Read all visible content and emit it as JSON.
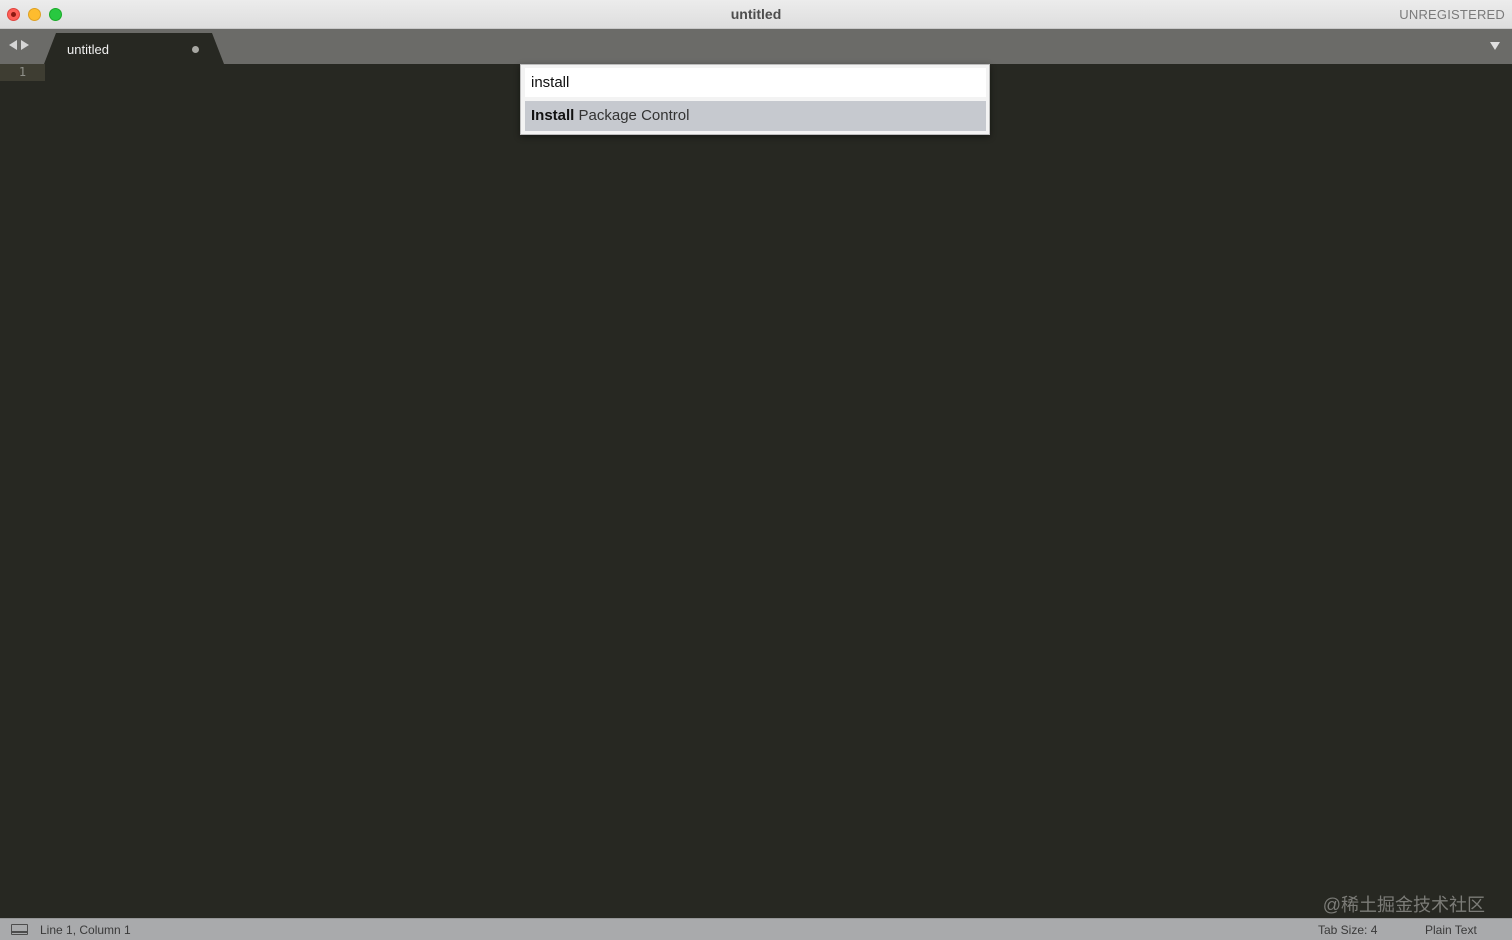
{
  "window": {
    "title": "untitled",
    "license_label": "UNREGISTERED"
  },
  "tabs": [
    {
      "label": "untitled",
      "dirty": true
    }
  ],
  "editor": {
    "line_numbers": [
      "1"
    ]
  },
  "command_palette": {
    "input_value": "install",
    "results": [
      {
        "match": "Install",
        "rest": " Package Control",
        "selected": true
      }
    ]
  },
  "watermark": {
    "text": "@稀土掘金技术社区"
  },
  "status_bar": {
    "position": "Line 1, Column 1",
    "tab_size": "Tab Size: 4",
    "syntax": "Plain Text"
  },
  "colors": {
    "editor_bg": "#272822",
    "tab_bar_bg": "#6b6b68",
    "selected_result_bg": "#c6c9cf",
    "status_bar_bg": "#a9aaac"
  },
  "icons": [
    "close-icon",
    "minimize-icon",
    "maximize-icon",
    "back-arrow-icon",
    "forward-arrow-icon",
    "tab-dirty-indicator-icon",
    "tab-list-menu-icon",
    "panel-toggle-icon"
  ]
}
